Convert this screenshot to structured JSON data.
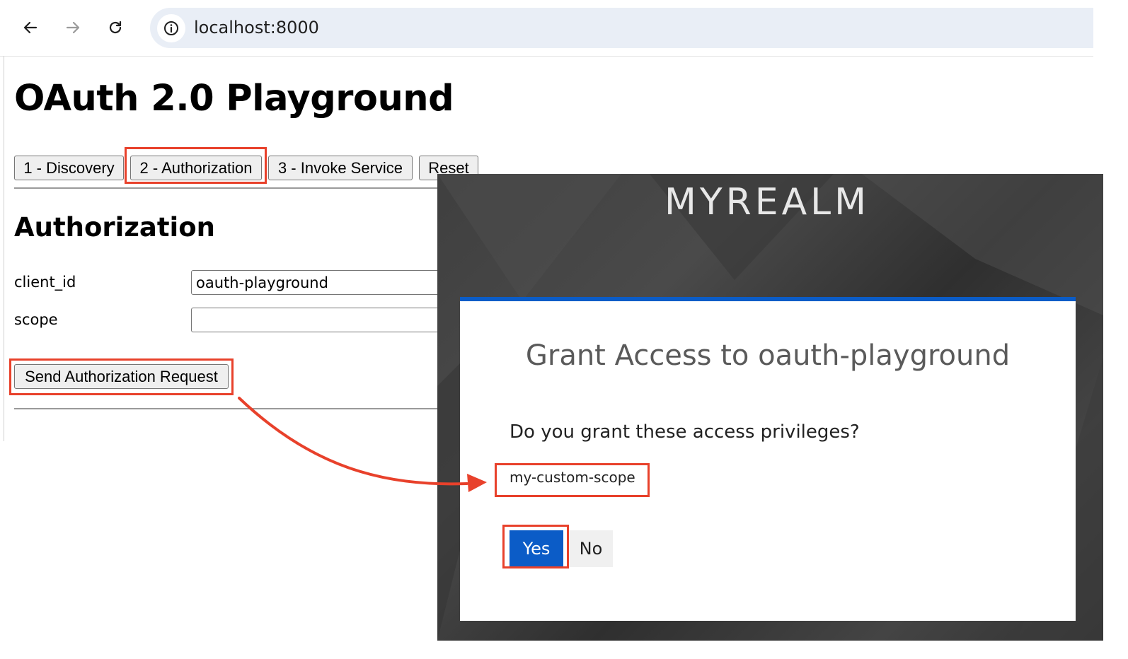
{
  "browser": {
    "url": "localhost:8000"
  },
  "page": {
    "title": "OAuth 2.0 Playground",
    "tabs": [
      {
        "label": "1 - Discovery"
      },
      {
        "label": "2 - Authorization"
      },
      {
        "label": "3 - Invoke Service"
      },
      {
        "label": "Reset"
      }
    ],
    "section_title": "Authorization",
    "fields": [
      {
        "label": "client_id",
        "value": "oauth-playground"
      },
      {
        "label": "scope",
        "value": ""
      }
    ],
    "send_button": "Send Authorization Request"
  },
  "consent": {
    "realm": "MYREALM",
    "heading": "Grant Access to oauth-playground",
    "question": "Do you grant these access privileges?",
    "scope": "my-custom-scope",
    "yes_label": "Yes",
    "no_label": "No"
  },
  "colors": {
    "highlight": "#e8412b",
    "accent": "#0b5cc7"
  }
}
